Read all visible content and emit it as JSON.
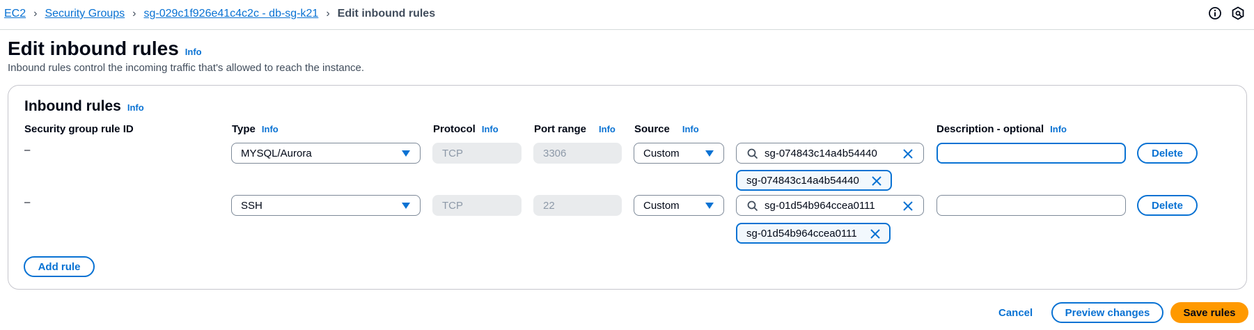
{
  "breadcrumb": {
    "items": [
      "EC2",
      "Security Groups",
      "sg-029c1f926e41c4c2c - db-sg-k21"
    ],
    "current": "Edit inbound rules"
  },
  "page": {
    "title": "Edit inbound rules",
    "info": "Info",
    "description": "Inbound rules control the incoming traffic that's allowed to reach the instance."
  },
  "panel": {
    "title": "Inbound rules",
    "info": "Info",
    "columns": {
      "rule_id": "Security group rule ID",
      "type": "Type",
      "protocol": "Protocol",
      "port_range": "Port range",
      "source": "Source",
      "description": "Description - optional",
      "info": "Info"
    },
    "rules": [
      {
        "rule_id": "–",
        "type": "MYSQL/Aurora",
        "protocol": "TCP",
        "port_range": "3306",
        "source": "Custom",
        "search_value": "sg-074843c14a4b54440",
        "token": "sg-074843c14a4b54440",
        "description": "",
        "delete_label": "Delete"
      },
      {
        "rule_id": "–",
        "type": "SSH",
        "protocol": "TCP",
        "port_range": "22",
        "source": "Custom",
        "search_value": "sg-01d54b964ccea0111",
        "token": "sg-01d54b964ccea0111",
        "description": "",
        "delete_label": "Delete"
      }
    ],
    "add_rule": "Add rule"
  },
  "footer": {
    "cancel": "Cancel",
    "preview": "Preview changes",
    "save": "Save rules"
  },
  "icons": {
    "info": "info-circle-icon",
    "feedback": "hexagon-feedback-icon"
  },
  "colors": {
    "link": "#0972d3",
    "primary_button": "#ff9900",
    "text": "#000716",
    "disabled_bg": "#e9ebed"
  }
}
